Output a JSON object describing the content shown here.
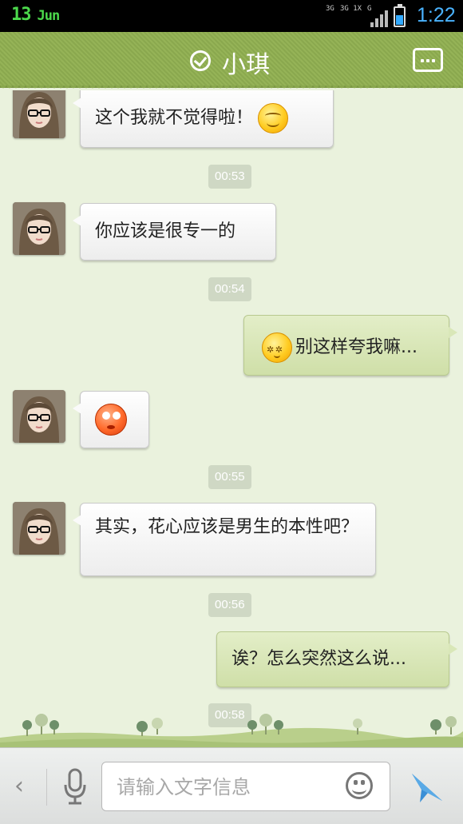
{
  "status_bar": {
    "date_day": "13",
    "date_month": "Jun",
    "network_1": "3G",
    "network_2": "3G 1X",
    "network_3": "G",
    "time": "1:22"
  },
  "header": {
    "title": "小琪"
  },
  "messages": [
    {
      "type": "incoming",
      "text": "这个我就不觉得啦！",
      "emoji": "smile-emoji"
    },
    {
      "type": "timestamp",
      "text": "00:53"
    },
    {
      "type": "incoming",
      "text": "你应该是很专一的"
    },
    {
      "type": "timestamp",
      "text": "00:54"
    },
    {
      "type": "outgoing",
      "text": "别这样夸我嘛...",
      "emoji": "shy-emoji"
    },
    {
      "type": "incoming",
      "text": "",
      "emoji": "eye-roll-emoji"
    },
    {
      "type": "timestamp",
      "text": "00:55"
    },
    {
      "type": "incoming",
      "text": "其实，花心应该是男生的本性吧？"
    },
    {
      "type": "timestamp",
      "text": "00:56"
    },
    {
      "type": "outgoing",
      "text": "诶？怎么突然这么说..."
    },
    {
      "type": "timestamp",
      "text": "00:58"
    }
  ],
  "input_bar": {
    "placeholder": "请输入文字信息"
  },
  "colors": {
    "header": "#8fad52",
    "chat_background": "#eaf2dd",
    "outgoing_bubble": "#d6e5b4",
    "incoming_bubble": "#f6f6f6",
    "time_text": "#4ab3ff",
    "send_icon": "#3a8fd6"
  }
}
